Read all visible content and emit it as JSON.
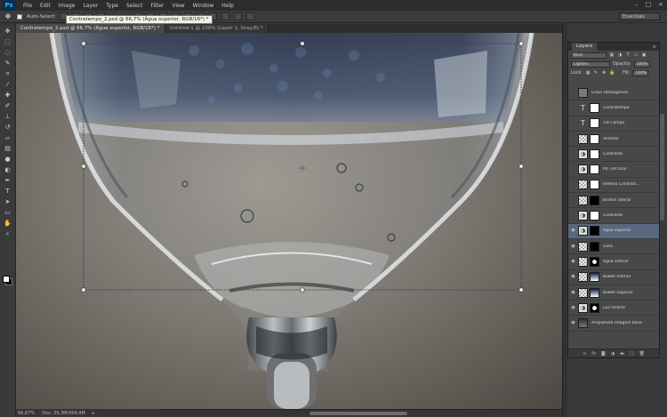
{
  "app": {
    "logo": "Ps"
  },
  "menu": [
    "File",
    "Edit",
    "Image",
    "Layer",
    "Type",
    "Select",
    "Filter",
    "View",
    "Window",
    "Help"
  ],
  "window_controls": [
    "–",
    "□",
    "×"
  ],
  "options": {
    "auto_select_label": "Auto-Select",
    "workspace": "Essentials",
    "tooltip": "Contratempo_2.psd @ 66,7% (Água superior, RGB/16*) *"
  },
  "tabs": [
    {
      "label": "Contratempo_2.psd @ 66,7% (Água superior, RGB/16*) *"
    },
    {
      "label": "Untitled-1 @ 100% (Layer 1, Gray/8) *"
    }
  ],
  "status": {
    "zoom": "66,67%",
    "doc": "Doc: 39,3M/304,4M"
  },
  "colors": {
    "fg": "#ffffff",
    "bg": "#000000",
    "selection": "#58687e",
    "panel": "#484848"
  },
  "layers_panel": {
    "title": "Layers",
    "kind_label": "Kind",
    "blend_mode": "Lighten",
    "opacity_label": "Opacity:",
    "opacity_value": "100%",
    "lock_label": "Lock:",
    "fill_label": "Fill:",
    "fill_value": "100%",
    "layers": [
      {
        "name": "Grain Homogenea",
        "thumb": "gray",
        "mask": "",
        "visible": false
      },
      {
        "name": "Contratempo",
        "thumb": "type",
        "mask": "white",
        "visible": false
      },
      {
        "name": "1st Campo",
        "thumb": "type",
        "mask": "white",
        "visible": false
      },
      {
        "name": "Vinheta",
        "thumb": "checker",
        "mask": "white",
        "visible": false
      },
      {
        "name": "Contraste",
        "thumb": "adj",
        "mask": "white",
        "visible": false
      },
      {
        "name": "Pb Tint Azul",
        "thumb": "adj",
        "mask": "white",
        "visible": false
      },
      {
        "name": "Reflexo Contrast...",
        "thumb": "checker",
        "mask": "white",
        "visible": false
      },
      {
        "name": "Brilhos lateral",
        "thumb": "checker",
        "mask": "black",
        "visible": false
      },
      {
        "name": "Contraste",
        "thumb": "adj",
        "mask": "white",
        "visible": false
      },
      {
        "name": "Água superior",
        "thumb": "adj",
        "mask": "black",
        "visible": true,
        "selected": true
      },
      {
        "name": "Gota",
        "thumb": "checker",
        "mask": "black",
        "visible": true
      },
      {
        "name": "Água inferior",
        "thumb": "checker",
        "mask": "mix",
        "visible": true
      },
      {
        "name": "Bokeh inferior",
        "thumb": "checker",
        "mask": "blue",
        "visible": true
      },
      {
        "name": "Bokeh superior",
        "thumb": "checker",
        "mask": "blue",
        "visible": true
      },
      {
        "name": "Luz central",
        "thumb": "adj",
        "mask": "mix",
        "visible": true
      },
      {
        "name": "Ampulheta Imagem base",
        "thumb": "photo",
        "mask": "",
        "visible": true
      }
    ],
    "footer_icons": [
      "link-icon",
      "fx-icon",
      "mask-icon",
      "adjustment-icon",
      "folder-icon",
      "new-layer-icon",
      "trash-icon"
    ]
  }
}
